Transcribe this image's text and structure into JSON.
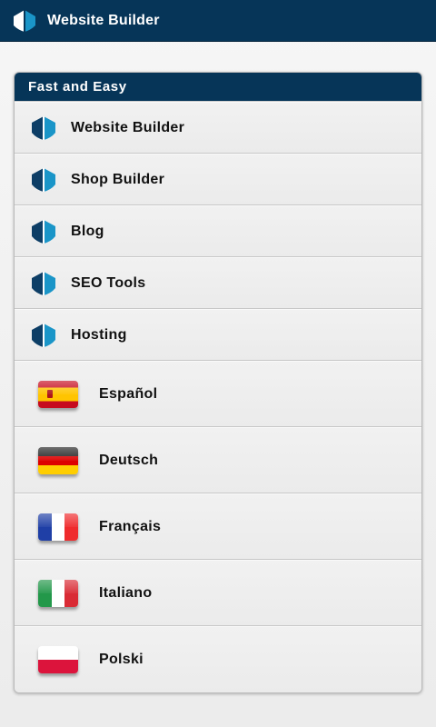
{
  "app": {
    "title": "Website Builder",
    "logo_icon": "ship-logo-icon"
  },
  "panel": {
    "header": "Fast and Easy",
    "products": [
      {
        "label": "Website Builder"
      },
      {
        "label": "Shop Builder"
      },
      {
        "label": "Blog"
      },
      {
        "label": "SEO Tools"
      },
      {
        "label": "Hosting"
      }
    ],
    "languages": [
      {
        "label": "Español",
        "flag": "spain-flag-icon"
      },
      {
        "label": "Deutsch",
        "flag": "germany-flag-icon"
      },
      {
        "label": "Français",
        "flag": "france-flag-icon"
      },
      {
        "label": "Italiano",
        "flag": "italy-flag-icon"
      },
      {
        "label": "Polski",
        "flag": "poland-flag-icon"
      }
    ]
  },
  "colors": {
    "brand": "#063558",
    "accent": "#1a95c8"
  }
}
